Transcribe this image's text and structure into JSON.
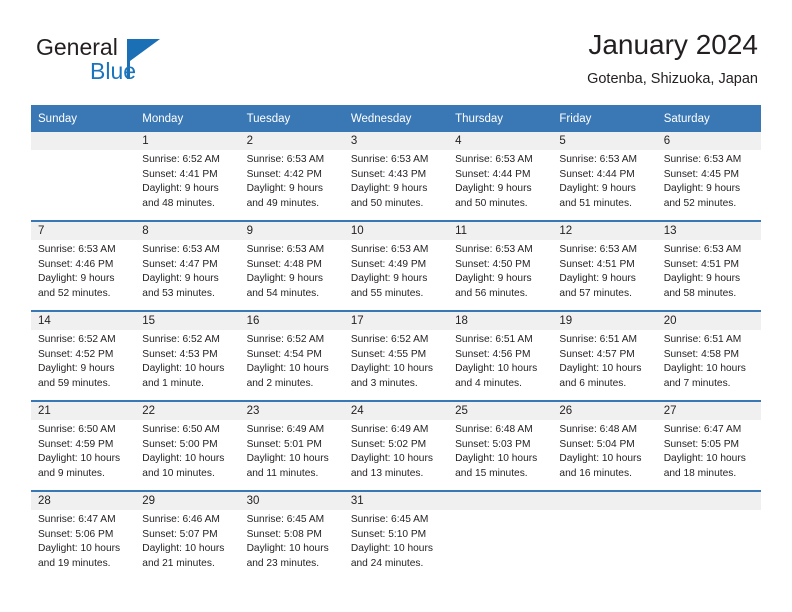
{
  "brand": {
    "name_part1": "General",
    "name_part2": "Blue",
    "logo_icon": "triangle-logo-icon"
  },
  "header": {
    "title": "January 2024",
    "subtitle": "Gotenba, Shizuoka, Japan"
  },
  "colors": {
    "header_blue": "#3a78b5",
    "brand_blue": "#1b75bc",
    "daynum_band": "#f0f0f0",
    "text": "#231f20"
  },
  "weekday_headers": [
    "Sunday",
    "Monday",
    "Tuesday",
    "Wednesday",
    "Thursday",
    "Friday",
    "Saturday"
  ],
  "weeks": [
    [
      {
        "day": "",
        "lines": []
      },
      {
        "day": "1",
        "lines": [
          "Sunrise: 6:52 AM",
          "Sunset: 4:41 PM",
          "Daylight: 9 hours",
          "and 48 minutes."
        ]
      },
      {
        "day": "2",
        "lines": [
          "Sunrise: 6:53 AM",
          "Sunset: 4:42 PM",
          "Daylight: 9 hours",
          "and 49 minutes."
        ]
      },
      {
        "day": "3",
        "lines": [
          "Sunrise: 6:53 AM",
          "Sunset: 4:43 PM",
          "Daylight: 9 hours",
          "and 50 minutes."
        ]
      },
      {
        "day": "4",
        "lines": [
          "Sunrise: 6:53 AM",
          "Sunset: 4:44 PM",
          "Daylight: 9 hours",
          "and 50 minutes."
        ]
      },
      {
        "day": "5",
        "lines": [
          "Sunrise: 6:53 AM",
          "Sunset: 4:44 PM",
          "Daylight: 9 hours",
          "and 51 minutes."
        ]
      },
      {
        "day": "6",
        "lines": [
          "Sunrise: 6:53 AM",
          "Sunset: 4:45 PM",
          "Daylight: 9 hours",
          "and 52 minutes."
        ]
      }
    ],
    [
      {
        "day": "7",
        "lines": [
          "Sunrise: 6:53 AM",
          "Sunset: 4:46 PM",
          "Daylight: 9 hours",
          "and 52 minutes."
        ]
      },
      {
        "day": "8",
        "lines": [
          "Sunrise: 6:53 AM",
          "Sunset: 4:47 PM",
          "Daylight: 9 hours",
          "and 53 minutes."
        ]
      },
      {
        "day": "9",
        "lines": [
          "Sunrise: 6:53 AM",
          "Sunset: 4:48 PM",
          "Daylight: 9 hours",
          "and 54 minutes."
        ]
      },
      {
        "day": "10",
        "lines": [
          "Sunrise: 6:53 AM",
          "Sunset: 4:49 PM",
          "Daylight: 9 hours",
          "and 55 minutes."
        ]
      },
      {
        "day": "11",
        "lines": [
          "Sunrise: 6:53 AM",
          "Sunset: 4:50 PM",
          "Daylight: 9 hours",
          "and 56 minutes."
        ]
      },
      {
        "day": "12",
        "lines": [
          "Sunrise: 6:53 AM",
          "Sunset: 4:51 PM",
          "Daylight: 9 hours",
          "and 57 minutes."
        ]
      },
      {
        "day": "13",
        "lines": [
          "Sunrise: 6:53 AM",
          "Sunset: 4:51 PM",
          "Daylight: 9 hours",
          "and 58 minutes."
        ]
      }
    ],
    [
      {
        "day": "14",
        "lines": [
          "Sunrise: 6:52 AM",
          "Sunset: 4:52 PM",
          "Daylight: 9 hours",
          "and 59 minutes."
        ]
      },
      {
        "day": "15",
        "lines": [
          "Sunrise: 6:52 AM",
          "Sunset: 4:53 PM",
          "Daylight: 10 hours",
          "and 1 minute."
        ]
      },
      {
        "day": "16",
        "lines": [
          "Sunrise: 6:52 AM",
          "Sunset: 4:54 PM",
          "Daylight: 10 hours",
          "and 2 minutes."
        ]
      },
      {
        "day": "17",
        "lines": [
          "Sunrise: 6:52 AM",
          "Sunset: 4:55 PM",
          "Daylight: 10 hours",
          "and 3 minutes."
        ]
      },
      {
        "day": "18",
        "lines": [
          "Sunrise: 6:51 AM",
          "Sunset: 4:56 PM",
          "Daylight: 10 hours",
          "and 4 minutes."
        ]
      },
      {
        "day": "19",
        "lines": [
          "Sunrise: 6:51 AM",
          "Sunset: 4:57 PM",
          "Daylight: 10 hours",
          "and 6 minutes."
        ]
      },
      {
        "day": "20",
        "lines": [
          "Sunrise: 6:51 AM",
          "Sunset: 4:58 PM",
          "Daylight: 10 hours",
          "and 7 minutes."
        ]
      }
    ],
    [
      {
        "day": "21",
        "lines": [
          "Sunrise: 6:50 AM",
          "Sunset: 4:59 PM",
          "Daylight: 10 hours",
          "and 9 minutes."
        ]
      },
      {
        "day": "22",
        "lines": [
          "Sunrise: 6:50 AM",
          "Sunset: 5:00 PM",
          "Daylight: 10 hours",
          "and 10 minutes."
        ]
      },
      {
        "day": "23",
        "lines": [
          "Sunrise: 6:49 AM",
          "Sunset: 5:01 PM",
          "Daylight: 10 hours",
          "and 11 minutes."
        ]
      },
      {
        "day": "24",
        "lines": [
          "Sunrise: 6:49 AM",
          "Sunset: 5:02 PM",
          "Daylight: 10 hours",
          "and 13 minutes."
        ]
      },
      {
        "day": "25",
        "lines": [
          "Sunrise: 6:48 AM",
          "Sunset: 5:03 PM",
          "Daylight: 10 hours",
          "and 15 minutes."
        ]
      },
      {
        "day": "26",
        "lines": [
          "Sunrise: 6:48 AM",
          "Sunset: 5:04 PM",
          "Daylight: 10 hours",
          "and 16 minutes."
        ]
      },
      {
        "day": "27",
        "lines": [
          "Sunrise: 6:47 AM",
          "Sunset: 5:05 PM",
          "Daylight: 10 hours",
          "and 18 minutes."
        ]
      }
    ],
    [
      {
        "day": "28",
        "lines": [
          "Sunrise: 6:47 AM",
          "Sunset: 5:06 PM",
          "Daylight: 10 hours",
          "and 19 minutes."
        ]
      },
      {
        "day": "29",
        "lines": [
          "Sunrise: 6:46 AM",
          "Sunset: 5:07 PM",
          "Daylight: 10 hours",
          "and 21 minutes."
        ]
      },
      {
        "day": "30",
        "lines": [
          "Sunrise: 6:45 AM",
          "Sunset: 5:08 PM",
          "Daylight: 10 hours",
          "and 23 minutes."
        ]
      },
      {
        "day": "31",
        "lines": [
          "Sunrise: 6:45 AM",
          "Sunset: 5:10 PM",
          "Daylight: 10 hours",
          "and 24 minutes."
        ]
      },
      {
        "day": "",
        "lines": []
      },
      {
        "day": "",
        "lines": []
      },
      {
        "day": "",
        "lines": []
      }
    ]
  ]
}
